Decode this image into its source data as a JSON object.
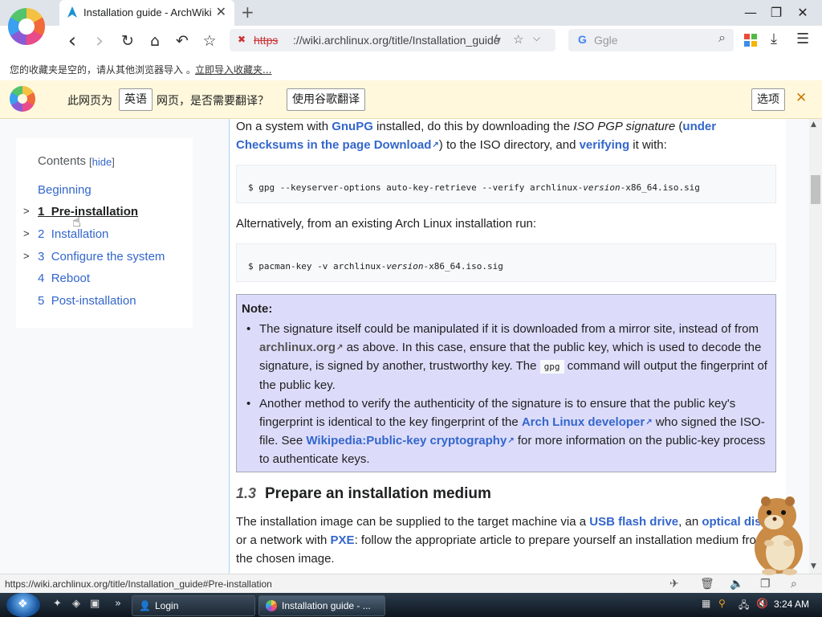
{
  "browser": {
    "tab": {
      "title": "Installation guide - ArchWiki",
      "close": "✕"
    },
    "new_tab": "+",
    "window_controls": {
      "minimize": "—",
      "maximize": "❐",
      "close": "✕"
    },
    "nav": {
      "back": "‹",
      "forward": "›",
      "reload": "↻",
      "home": "⌂",
      "undo": "↶",
      "bookmark": "☆"
    },
    "address": {
      "protocol": "https",
      "url": "://wiki.archlinux.org/title/Installation_guide"
    },
    "search": {
      "engine": "G",
      "placeholder": "Ggle"
    },
    "bookmarks_bar": {
      "message": "您的收藏夹是空的，请从其他浏览器导入 。",
      "import_link": "立即导入收藏夹..."
    },
    "translate_bar": {
      "prefix": "此网页为",
      "language": "英语",
      "question": "网页，是否需要翻译？",
      "translate_button": "使用谷歌翻译",
      "options_button": "选项",
      "close": "✕"
    },
    "status_url": "https://wiki.archlinux.org/title/Installation_guide#Pre-installation"
  },
  "toc": {
    "title": "Contents",
    "hide": "hide",
    "items": [
      {
        "label": "Beginning",
        "num": "",
        "expandable": false
      },
      {
        "label": "Pre-installation",
        "num": "1",
        "expandable": true
      },
      {
        "label": "Installation",
        "num": "2",
        "expandable": true
      },
      {
        "label": "Configure the system",
        "num": "3",
        "expandable": true
      },
      {
        "label": "Reboot",
        "num": "4",
        "expandable": false
      },
      {
        "label": "Post-installation",
        "num": "5",
        "expandable": false
      }
    ]
  },
  "article": {
    "p1": {
      "a": "On a system with ",
      "gnupg": "GnuPG",
      "b": " installed, do this by downloading the ",
      "pgp": "ISO PGP signature",
      "c": " (",
      "checksums": "under Checksums in the page Download",
      "d": ") to the ISO directory, and ",
      "verifying": "verifying",
      "e": " it with:"
    },
    "code1": {
      "pre": "$ gpg --keyserver-options auto-key-retrieve --verify archlinux-",
      "var": "version",
      "post": "-x86_64.iso.sig"
    },
    "p2": "Alternatively, from an existing Arch Linux installation run:",
    "code2": {
      "pre": "$ pacman-key -v archlinux-",
      "var": "version",
      "post": "-x86_64.iso.sig"
    },
    "note": {
      "title": "Note:",
      "li1": {
        "a": "The signature itself could be manipulated if it is downloaded from a mirror site, instead of from ",
        "link": "archlinux.org",
        "b": " as above. In this case, ensure that the public key, which is used to decode the signature, is signed by another, trustworthy key. The ",
        "code": "gpg",
        "c": " command will output the fingerprint of the public key."
      },
      "li2": {
        "a": "Another method to verify the authenticity of the signature is to ensure that the public key's fingerprint is identical to the key fingerprint of the ",
        "link1": "Arch Linux developer",
        "b": " who signed the ISO-file. See ",
        "link2": "Wikipedia:Public-key cryptography",
        "c": " for more information on the public-key process to authenticate keys."
      }
    },
    "section": {
      "num": "1.3",
      "title": "Prepare an installation medium"
    },
    "p3": {
      "a": "The installation image can be supplied to the target machine via a ",
      "usb": "USB flash drive",
      "b": ", an ",
      "optical": "optical dis",
      "c": " or a network with ",
      "pxe": "PXE",
      "d": ": follow the appropriate article to prepare yourself an installation medium from the chosen image."
    }
  },
  "taskbar": {
    "tasks": [
      {
        "label": "Login"
      },
      {
        "label": "Installation guide - ..."
      }
    ],
    "time": "3:24 AM"
  },
  "colors": {
    "link": "#3366cc",
    "note_bg": "#dcdcfa",
    "translate_bg": "#fff8dc"
  }
}
